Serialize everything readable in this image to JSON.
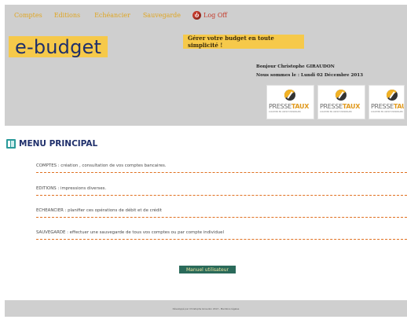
{
  "nav": {
    "items": [
      "Comptes",
      "Editions",
      "Echéancier",
      "Sauvegarde"
    ],
    "logout": "Log Off"
  },
  "header": {
    "brand": "e-budget",
    "slogan": "Gérer votre budget en toute simplicité !",
    "greeting": "Bonjour Christophe  GIRAUDON",
    "date_label": "Nous sommes le :",
    "date": "Lundi 02 Décembre 2013"
  },
  "banners": [
    {
      "brand_a": "PRESSE",
      "brand_b": "TAUX",
      "tagline": "COURTIER EN CREDIT IMMOBILIER"
    },
    {
      "brand_a": "PRESSE",
      "brand_b": "TAUX",
      "tagline": "COURTIER EN CREDIT IMMOBILIER"
    },
    {
      "brand_a": "PRESSE",
      "brand_b": "TAUX",
      "tagline": "COURTIER EN CREDIT IMMOBILIER"
    }
  ],
  "main": {
    "title": "MENU PRINCIPAL",
    "items": [
      "COMPTES : création , consultation de vos comptes bancaires.",
      "EDITIONS : impressions diverses.",
      "ECHEANCIER : planifier ces opérations de débit et de crédit",
      "SAUVEGARDE : effectuer une sauvegarde de tous vos comptes ou par compte individuel"
    ],
    "manual_button": "Manuel utilisateur"
  },
  "footer": {
    "copyright": "Développé par Christophe Giraudon 2013 -",
    "legal": "Mentions légales"
  },
  "colors": {
    "nav_text": "#e0a520",
    "brand_bg": "#f6c94a",
    "brand_text": "#1f2f6b",
    "header_bg": "#cfcfcf",
    "separator": "#e07020",
    "button_bg": "#2a6a5a"
  }
}
